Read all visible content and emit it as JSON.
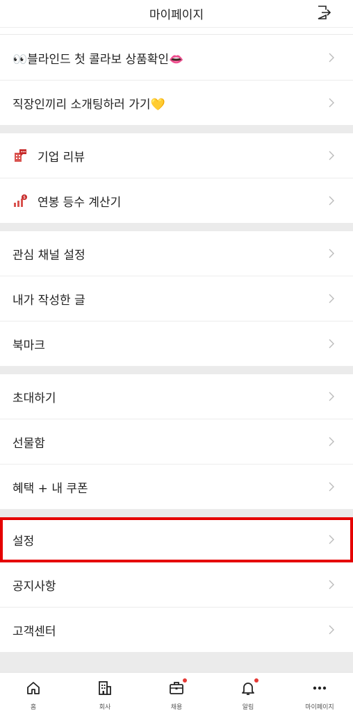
{
  "header": {
    "title": "마이페이지"
  },
  "sections": [
    {
      "items": [
        {
          "label": "👀블라인드 첫 콜라보 상품확인👄"
        },
        {
          "label": "직장인끼리 소개팅하러 가기💛"
        }
      ]
    },
    {
      "items": [
        {
          "label": "기업 리뷰",
          "icon": "company-review-icon"
        },
        {
          "label": "연봉 등수 계산기",
          "icon": "salary-rank-icon"
        }
      ]
    },
    {
      "items": [
        {
          "label": "관심 채널 설정"
        },
        {
          "label": "내가 작성한 글"
        },
        {
          "label": "북마크"
        }
      ]
    },
    {
      "items": [
        {
          "label": "초대하기"
        },
        {
          "label": "선물함"
        },
        {
          "label": "혜택 + 내 쿠폰"
        }
      ]
    },
    {
      "items": [
        {
          "label": "설정"
        },
        {
          "label": "공지사항"
        },
        {
          "label": "고객센터"
        }
      ]
    }
  ],
  "tabbar": [
    {
      "label": "홈",
      "icon": "home-icon"
    },
    {
      "label": "회사",
      "icon": "building-icon"
    },
    {
      "label": "채용",
      "icon": "briefcase-icon"
    },
    {
      "label": "알림",
      "icon": "bell-icon"
    },
    {
      "label": "마이페이지",
      "icon": "more-icon"
    }
  ],
  "colors": {
    "highlight": "#e50000",
    "accent": "#e53935",
    "gap": "#ebebeb"
  }
}
